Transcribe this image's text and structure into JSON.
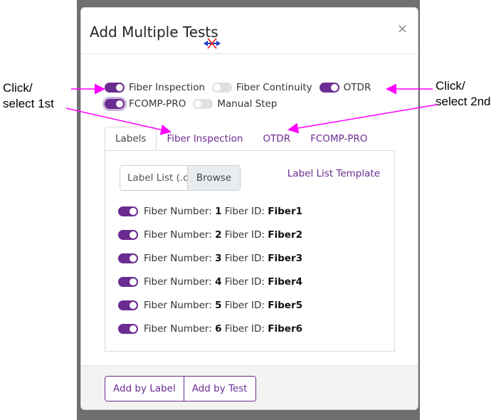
{
  "modal": {
    "title": "Add Multiple Tests",
    "close_label": "×"
  },
  "test_toggles": [
    {
      "label": "Fiber Inspection",
      "on": true
    },
    {
      "label": "Fiber Continuity",
      "on": false
    },
    {
      "label": "OTDR",
      "on": true
    },
    {
      "label": "FCOMP-PRO",
      "on": true
    },
    {
      "label": "Manual Step",
      "on": false
    }
  ],
  "tabs": [
    {
      "label": "Labels",
      "active": true
    },
    {
      "label": "Fiber Inspection",
      "active": false
    },
    {
      "label": "OTDR",
      "active": false
    },
    {
      "label": "FCOMP-PRO",
      "active": false
    }
  ],
  "labels_panel": {
    "file_input_placeholder": "Label List (.c",
    "browse_label": "Browse",
    "template_link": "Label List Template",
    "fiber_number_label": "Fiber Number:",
    "fiber_id_label": "Fiber ID:",
    "fibers": [
      {
        "number": "1",
        "id": "Fiber1",
        "on": true
      },
      {
        "number": "2",
        "id": "Fiber2",
        "on": true
      },
      {
        "number": "3",
        "id": "Fiber3",
        "on": true
      },
      {
        "number": "4",
        "id": "Fiber4",
        "on": true
      },
      {
        "number": "5",
        "id": "Fiber5",
        "on": true
      },
      {
        "number": "6",
        "id": "Fiber6",
        "on": true
      }
    ]
  },
  "footer": {
    "add_by_label": "Add by Label",
    "add_by_test": "Add by Test"
  },
  "annotations": {
    "left_line1": "Click/",
    "left_line2": "select 1st",
    "right_line1": "Click/",
    "right_line2": "select 2nd"
  },
  "colors": {
    "accent": "#6b2c91",
    "annotation_arrow": "#ff00ff"
  }
}
